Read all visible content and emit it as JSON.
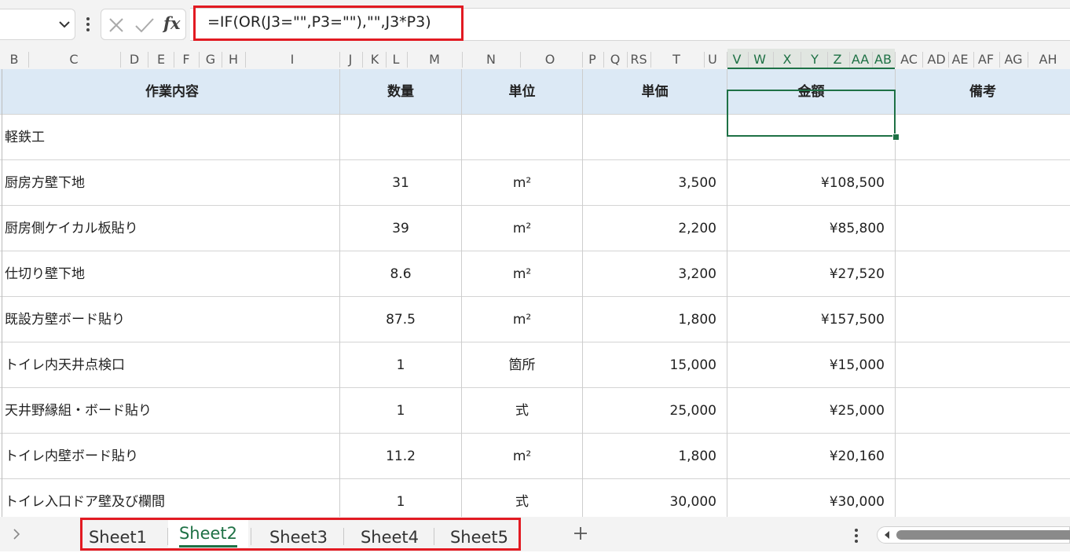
{
  "formula_bar": {
    "formula": "=IF(OR(J3=\"\",P3=\"\"),\"\",J3*P3)",
    "fx_label": "fx"
  },
  "columns": [
    "B",
    "C",
    "D",
    "E",
    "F",
    "G",
    "H",
    "I",
    "J",
    "K",
    "L",
    "M",
    "N",
    "O",
    "P",
    "Q",
    "RS",
    "T",
    "U",
    "V",
    "W",
    "X",
    "Y",
    "Z",
    "AA",
    "AB",
    "AC",
    "AD",
    "AE",
    "AF",
    "AG",
    "AH"
  ],
  "selected_columns": [
    "V",
    "W",
    "X",
    "Y",
    "Z",
    "AA",
    "AB"
  ],
  "table": {
    "headers": {
      "item": "作業内容",
      "qty": "数量",
      "unit": "単位",
      "price": "単価",
      "amount": "金額",
      "note": "備考"
    },
    "rows": [
      {
        "item": "軽鉄工",
        "qty": "",
        "unit": "",
        "price": "",
        "amount": "",
        "note": ""
      },
      {
        "item": "厨房方壁下地",
        "qty": "31",
        "unit": "m²",
        "price": "3,500",
        "amount": "¥108,500",
        "note": ""
      },
      {
        "item": "厨房側ケイカル板貼り",
        "qty": "39",
        "unit": "m²",
        "price": "2,200",
        "amount": "¥85,800",
        "note": ""
      },
      {
        "item": "仕切り壁下地",
        "qty": "8.6",
        "unit": "m²",
        "price": "3,200",
        "amount": "¥27,520",
        "note": ""
      },
      {
        "item": "既設方壁ボード貼り",
        "qty": "87.5",
        "unit": "m²",
        "price": "1,800",
        "amount": "¥157,500",
        "note": ""
      },
      {
        "item": "トイレ内天井点検口",
        "qty": "1",
        "unit": "箇所",
        "price": "15,000",
        "amount": "¥15,000",
        "note": ""
      },
      {
        "item": "天井野縁組・ボード貼り",
        "qty": "1",
        "unit": "式",
        "price": "25,000",
        "amount": "¥25,000",
        "note": ""
      },
      {
        "item": "トイレ内壁ボード貼り",
        "qty": "11.2",
        "unit": "m²",
        "price": "1,800",
        "amount": "¥20,160",
        "note": ""
      },
      {
        "item": "トイレ入口ドア壁及び欄間",
        "qty": "1",
        "unit": "式",
        "price": "30,000",
        "amount": "¥30,000",
        "note": ""
      }
    ]
  },
  "sheet_tabs": {
    "tabs": [
      "Sheet1",
      "Sheet2",
      "Sheet3",
      "Sheet4",
      "Sheet5"
    ],
    "active": "Sheet2",
    "add_symbol": "+"
  },
  "colors": {
    "accent": "#1e7145",
    "header_fill": "#dce9f5",
    "highlight": "#e21a22"
  }
}
